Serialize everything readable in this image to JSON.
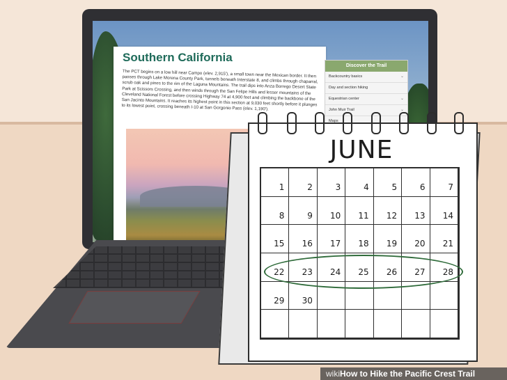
{
  "article": {
    "title": "Southern California",
    "body": "The PCT begins on a low hill near Campo (elev. 2,915'), a small town near the Mexican border. It then passes through Lake Morena County Park, tunnels beneath Interstate 8, and climbs through chaparral, scrub oak and pines to the rim of the Laguna Mountains. The trail dips into Anza Borrego Desert State Park at Scissors Crossing, and then winds through the San Felipe Hills and lesser mountains of the Cleveland National Forest before crossing Highway 74 at 4,900 feet and climbing the backbone of the San Jacinto Mountains. It reaches its highest point in this section at 9,030 feet shortly before it plunges to its lowest point, crossing beneath I-10 at San Gorgonio Pass (elev. 1,190')."
  },
  "sidebar": {
    "title": "Discover the Trail",
    "items": [
      {
        "label": "Backcountry basics"
      },
      {
        "label": "Day and section hiking"
      },
      {
        "label": "Equestrian center"
      },
      {
        "label": "John Muir Trail"
      },
      {
        "label": "Maps"
      }
    ]
  },
  "calendar": {
    "month": "JUNE",
    "days": [
      "",
      "1",
      "2",
      "3",
      "4",
      "5",
      "6",
      "7",
      "8",
      "9",
      "10",
      "11",
      "12",
      "13",
      "14",
      "15",
      "16",
      "17",
      "18",
      "19",
      "20",
      "21",
      "22",
      "23",
      "24",
      "25",
      "26",
      "27",
      "28",
      "29",
      "30",
      "",
      "",
      "",
      "",
      "",
      "",
      "",
      "",
      "",
      "",
      "",
      ""
    ],
    "circled_week": [
      "22",
      "23",
      "24",
      "25",
      "26",
      "27",
      "28"
    ]
  },
  "footer": {
    "brand": "wiki",
    "title": "How to Hike the Pacific Crest Trail"
  },
  "colors": {
    "title_green": "#1f6b5a",
    "sidebar_header": "#8aa86e",
    "circle_green": "#2f6b3a"
  }
}
